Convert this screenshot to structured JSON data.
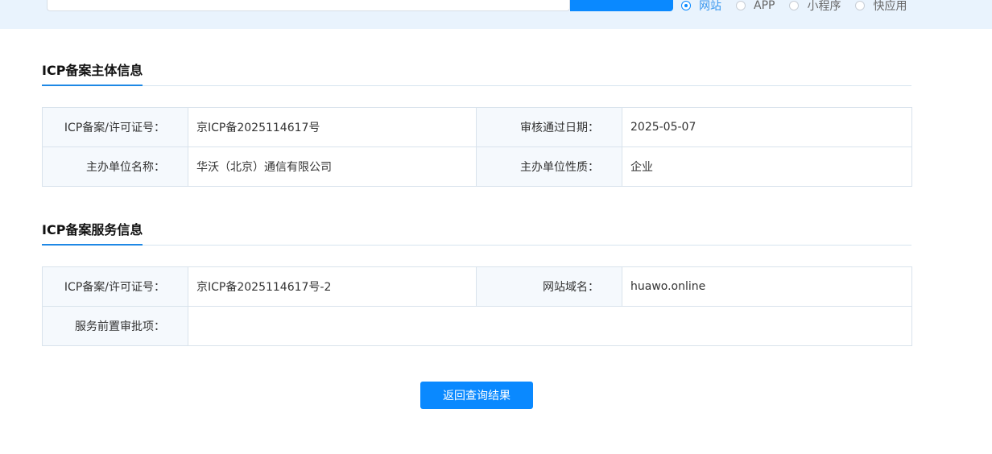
{
  "search": {
    "value": "",
    "types": [
      {
        "label": "网站",
        "checked": true
      },
      {
        "label": "APP",
        "checked": false
      },
      {
        "label": "小程序",
        "checked": false
      },
      {
        "label": "快应用",
        "checked": false
      }
    ]
  },
  "subject": {
    "title": "ICP备案主体信息",
    "rows": [
      {
        "k1": "ICP备案/许可证号：",
        "v1": "京ICP备2025114617号",
        "k2": "审核通过日期：",
        "v2": "2025-05-07"
      },
      {
        "k1": "主办单位名称：",
        "v1": "华沃（北京）通信有限公司",
        "k2": "主办单位性质：",
        "v2": "企业"
      }
    ]
  },
  "service": {
    "title": "ICP备案服务信息",
    "row1": {
      "k1": "ICP备案/许可证号：",
      "v1": "京ICP备2025114617号-2",
      "k2": "网站域名：",
      "v2": "huawo.online"
    },
    "row2": {
      "k1": "服务前置审批项：",
      "v1": ""
    }
  },
  "back_button": "返回查询结果",
  "colors": {
    "accent": "#0a89ff",
    "topbar_bg": "#e9f3fd",
    "label_bg": "#f5f9fd"
  }
}
